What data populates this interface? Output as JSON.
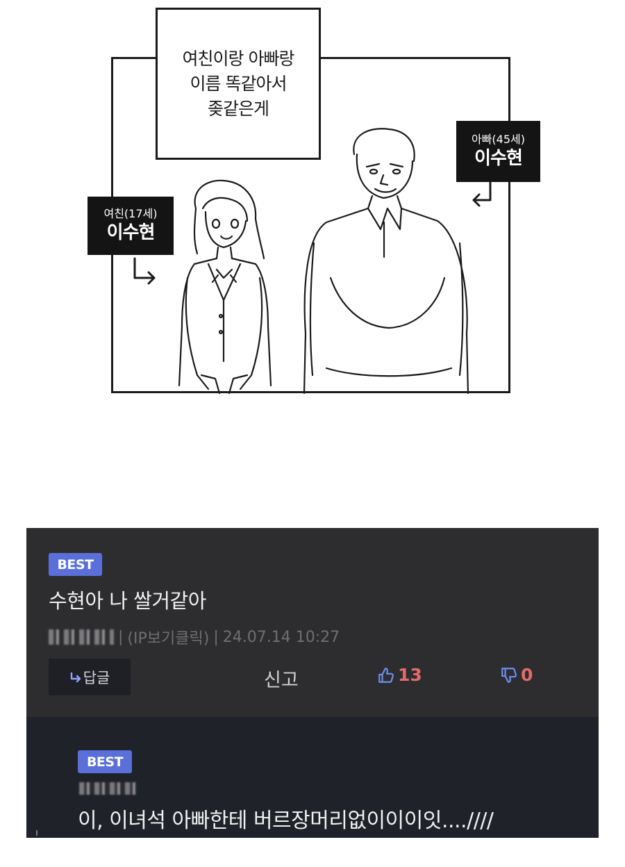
{
  "comic": {
    "caption_lines": [
      "여친이랑 아빠랑",
      "이름 똑같아서",
      "좆같은게"
    ],
    "girlfriend_tag": {
      "role": "여친(17세)",
      "name": "이수현"
    },
    "dad_tag": {
      "role": "아빠(45세)",
      "name": "이수현"
    }
  },
  "comment": {
    "badge": "BEST",
    "text": "수현아 나 쌀거같아",
    "ip_label": "(IP보기클릭)",
    "separator": "|",
    "timestamp": "24.07.14 10:27",
    "reply_label": "답글",
    "report_label": "신고",
    "likes": "13",
    "dislikes": "0"
  },
  "reply": {
    "badge": "BEST",
    "text": "이, 이녀석 아빠한테 버르장머리없이이이잇....////"
  },
  "colors": {
    "panel_bg": "#2d2d30",
    "reply_bg": "#1f2228",
    "badge": "#5b6fd9",
    "vote_count": "#e36b6b",
    "vote_icon": "#5b7fd9"
  }
}
